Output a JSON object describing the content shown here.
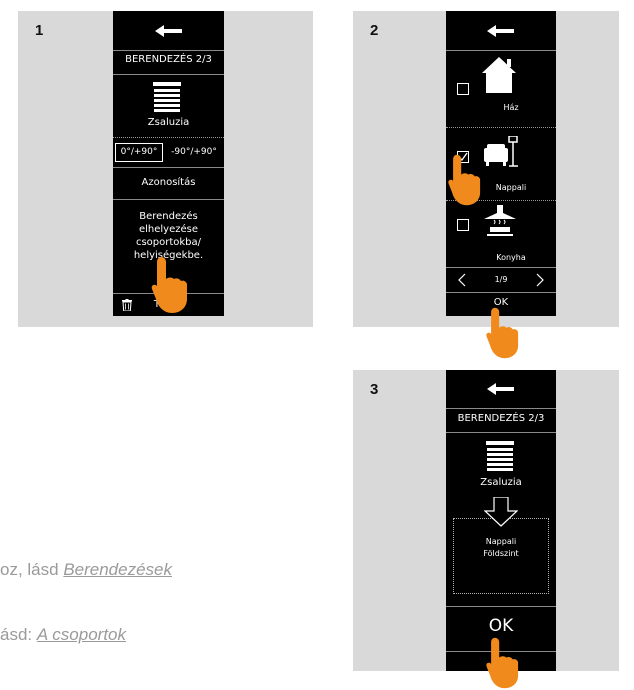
{
  "panels": {
    "p1": {
      "number": "1",
      "header_title": "BERENDEZÉS 2/3",
      "device_name": "Zsaluzia",
      "angle_option_1": "0°/+90°",
      "angle_option_2": "-90°/+90°",
      "identify_label": "Azonosítás",
      "assign_lines": [
        "Berendezés",
        "elhelyezése",
        "csoportokba/",
        "helyiségekbe."
      ],
      "delete_label": "Törlés"
    },
    "p2": {
      "number": "2",
      "room_1": "Ház",
      "room_2": "Nappali",
      "room_3": "Konyha",
      "pagination": "1/9",
      "ok_label": "OK"
    },
    "p3": {
      "number": "3",
      "header_title": "BERENDEZÉS 2/3",
      "device_name": "Zsaluzia",
      "target_room": "Nappali",
      "target_floor": "Földszint",
      "ok_label": "OK"
    }
  },
  "background_text": {
    "line1_prefix": "oz, lásd ",
    "line1_link": "Berendezések",
    "line2_prefix": "ásd: ",
    "line2_link": "A csoportok"
  },
  "colors": {
    "panel_bg": "#d9d9d9",
    "remote_bg": "#000000",
    "hand": "#f18a1d"
  },
  "icons": [
    "back-arrow-icon",
    "blind-icon",
    "trash-icon",
    "house-icon",
    "sofa-lamp-icon",
    "kitchen-hood-icon",
    "chevron-left-icon",
    "chevron-right-icon",
    "arrow-down-icon",
    "hand-pointer-icon"
  ]
}
